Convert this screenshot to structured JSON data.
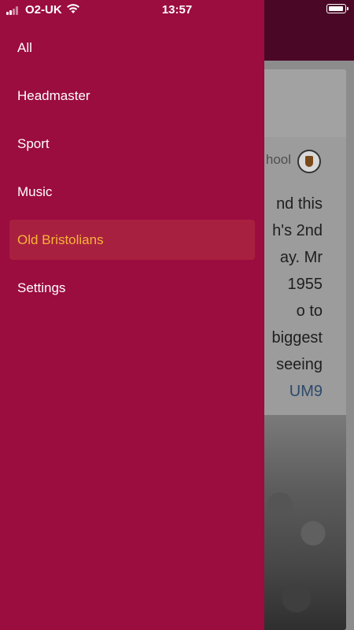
{
  "status_bar": {
    "carrier": "O2-UK",
    "time": "13:57"
  },
  "drawer": {
    "items": [
      {
        "label": "All",
        "active": false
      },
      {
        "label": "Headmaster",
        "active": false
      },
      {
        "label": "Sport",
        "active": false
      },
      {
        "label": "Music",
        "active": false
      },
      {
        "label": "Old Bristolians",
        "active": true
      },
      {
        "label": "Settings",
        "active": false
      }
    ],
    "colors": {
      "background": "#9b0c3f",
      "active_background": "#a8203f",
      "active_text": "#f7b33a"
    }
  },
  "background_post": {
    "author_fragment": "hool",
    "text_lines": [
      "nd this",
      "h's 2nd",
      "ay. Mr",
      "1955",
      "o to",
      "biggest",
      "seeing"
    ],
    "link_fragment": "UM9"
  }
}
